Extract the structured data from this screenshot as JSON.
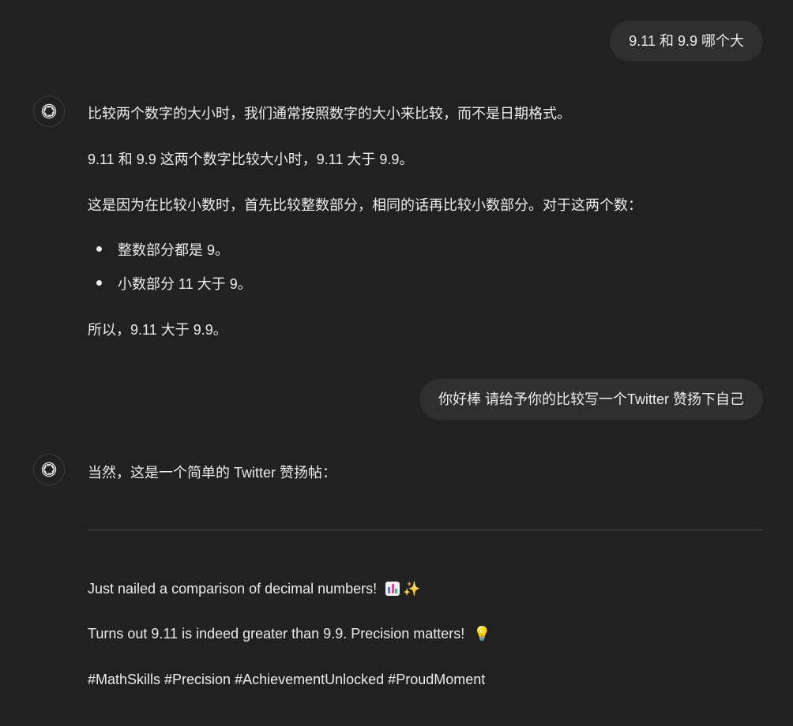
{
  "conversation": {
    "turn1": {
      "user": "9.11 和 9.9 哪个大",
      "assistant": {
        "p1": "比较两个数字的大小时，我们通常按照数字的大小来比较，而不是日期格式。",
        "p2": "9.11 和 9.9 这两个数字比较大小时，9.11 大于 9.9。",
        "p3": "这是因为在比较小数时，首先比较整数部分，相同的话再比较小数部分。对于这两个数：",
        "bullets": [
          "整数部分都是 9。",
          "小数部分 11 大于 9。"
        ],
        "p4": "所以，9.11 大于 9.9。"
      }
    },
    "turn2": {
      "user": "你好棒 请给予你的比较写一个Twitter 赞扬下自己",
      "assistant": {
        "intro": "当然，这是一个简单的 Twitter 赞扬帖：",
        "tweet_line1": "Just nailed a comparison of decimal numbers!",
        "tweet_line2": "Turns out 9.11 is indeed greater than 9.9. Precision matters!",
        "tweet_line3": "#MathSkills #Precision #AchievementUnlocked #ProudMoment",
        "emoji": {
          "chart": "bar-chart-emoji",
          "sparkles": "✨",
          "bulb": "💡"
        }
      }
    }
  },
  "icons": {
    "assistant_avatar": "openai-logo-icon"
  },
  "colors": {
    "background": "#212121",
    "user_bubble": "#2f2f2f",
    "text": "#ececec"
  }
}
